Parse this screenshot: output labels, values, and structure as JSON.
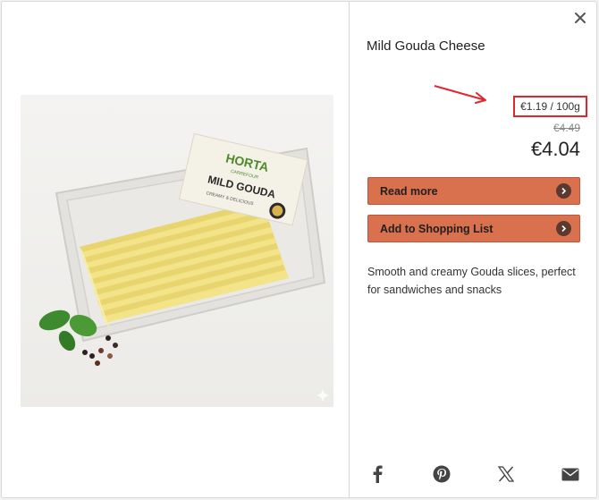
{
  "product": {
    "title": "Mild Gouda Cheese",
    "unit_price": "€1.19 / 100g",
    "old_price": "€4.49",
    "price": "€4.04",
    "description": "Smooth and creamy Gouda slices, perfect for sandwiches and snacks"
  },
  "packaging": {
    "brand": "HORTA",
    "brand_sub": "CARREFOUR",
    "product_name": "MILD GOUDA",
    "tagline": "CREAMY & DELICIOUS"
  },
  "actions": {
    "read_more": "Read more",
    "add_to_list": "Add to Shopping List"
  },
  "share": {
    "icons": [
      "facebook-icon",
      "pinterest-icon",
      "x-icon",
      "email-icon"
    ]
  },
  "colors": {
    "button": "#d9704e",
    "highlight_box": "#e0262f"
  }
}
